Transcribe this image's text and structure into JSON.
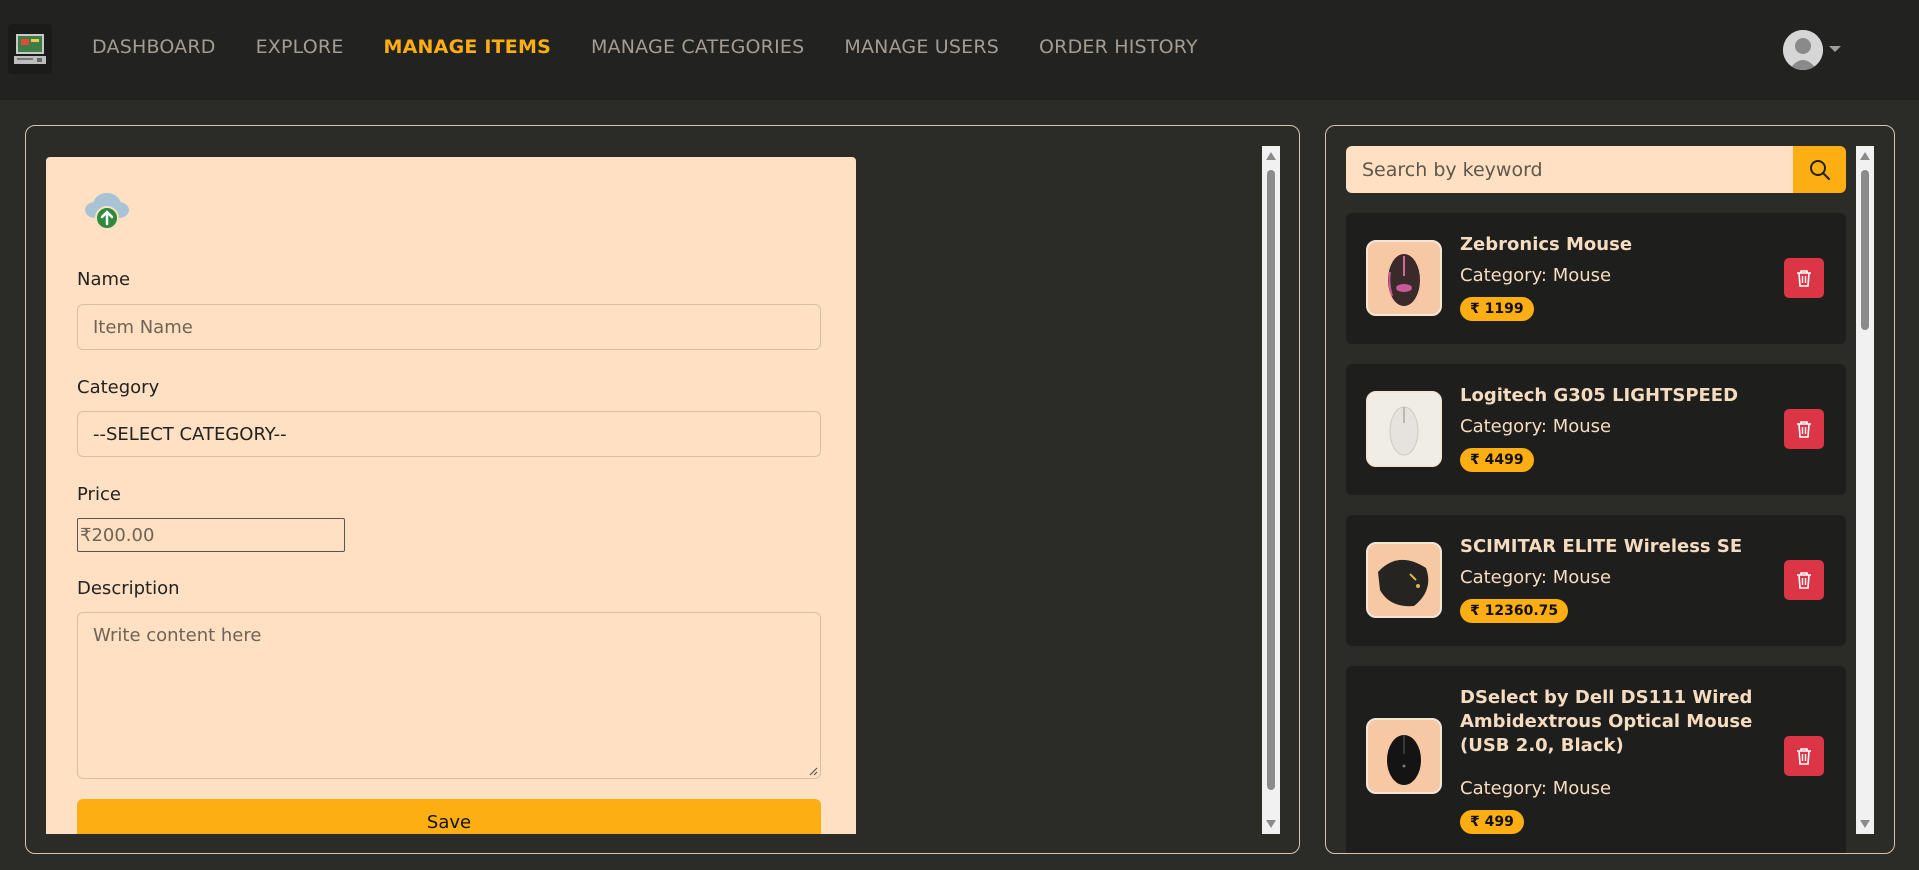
{
  "nav": {
    "items": [
      {
        "label": "DASHBOARD",
        "active": false
      },
      {
        "label": "EXPLORE",
        "active": false
      },
      {
        "label": "MANAGE ITEMS",
        "active": true
      },
      {
        "label": "MANAGE CATEGORIES",
        "active": false
      },
      {
        "label": "MANAGE USERS",
        "active": false
      },
      {
        "label": "ORDER HISTORY",
        "active": false
      }
    ],
    "accent_color": "#fdae12"
  },
  "form": {
    "name_label": "Name",
    "name_placeholder": "Item Name",
    "category_label": "Category",
    "category_selected": "--SELECT CATEGORY--",
    "price_label": "Price",
    "price_placeholder": "₹200.00",
    "description_label": "Description",
    "description_placeholder": "Write content here",
    "save_label": "Save",
    "upload_icon": "cloud-upload-icon"
  },
  "search": {
    "placeholder": "Search by keyword",
    "icon": "search-icon"
  },
  "items": [
    {
      "name": "Zebronics Mouse",
      "category": "Category: Mouse",
      "price": "₹ 1199"
    },
    {
      "name": "Logitech G305 LIGHTSPEED",
      "category": "Category: Mouse",
      "price": "₹ 4499"
    },
    {
      "name": "SCIMITAR ELITE Wireless SE",
      "category": "Category: Mouse",
      "price": "₹ 12360.75"
    },
    {
      "name": "DSelect by Dell DS111 Wired Ambidextrous Optical Mouse (USB 2.0, Black)",
      "category": "Category: Mouse",
      "price": "₹ 499"
    }
  ],
  "colors": {
    "background": "#2b2b28",
    "navbar": "#222220",
    "form_card": "#ffe0c2",
    "delete": "#dc3545"
  }
}
